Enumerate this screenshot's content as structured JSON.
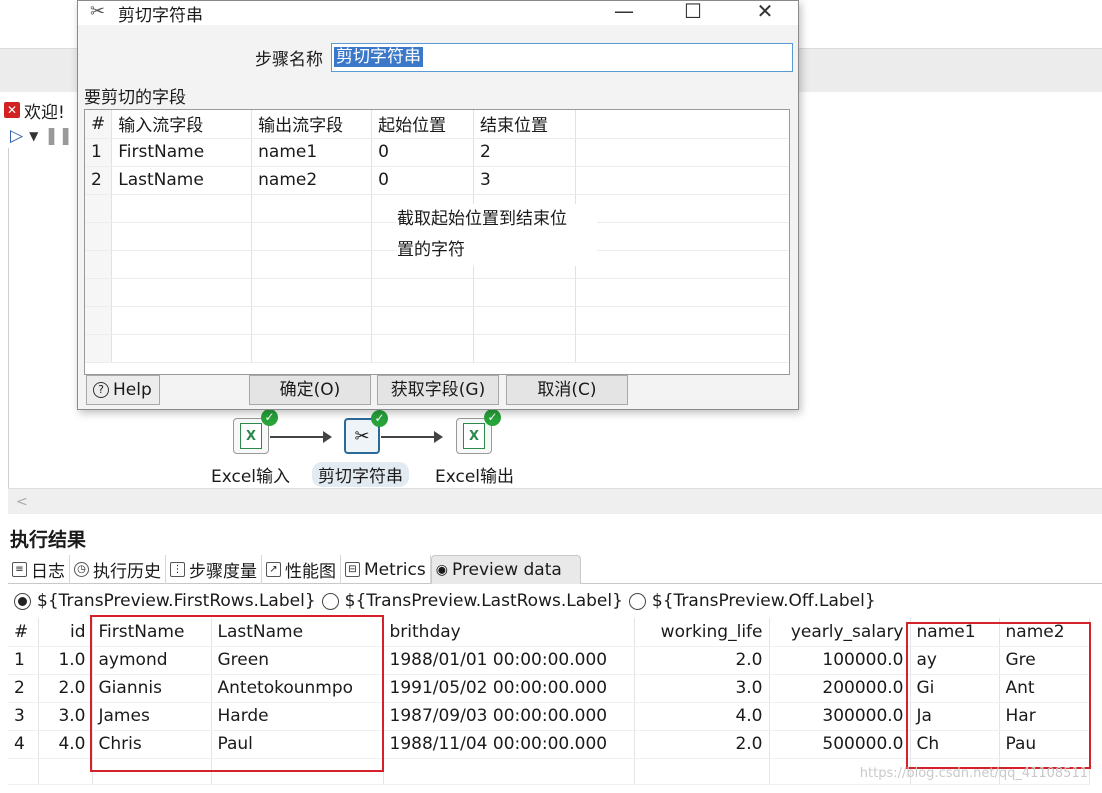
{
  "app": {
    "welcome_tab": "欢迎!",
    "welcome_icon": "close-icon",
    "scroll_left_glyph": "<"
  },
  "flow": {
    "nodes": [
      {
        "label": "Excel输入",
        "icon": "excel-input-icon"
      },
      {
        "label": "剪切字符串",
        "icon": "scissors-icon"
      },
      {
        "label": "Excel输出",
        "icon": "excel-output-icon"
      }
    ]
  },
  "results": {
    "title": "执行结果",
    "tabs": [
      "日志",
      "执行历史",
      "步骤度量",
      "性能图",
      "Metrics",
      "Preview data"
    ],
    "radios": [
      {
        "label": "${TransPreview.FirstRows.Label}",
        "checked": true
      },
      {
        "label": "${TransPreview.LastRows.Label}",
        "checked": false
      },
      {
        "label": "${TransPreview.Off.Label}",
        "checked": false
      }
    ],
    "columns": [
      "#",
      "id",
      "FirstName",
      "LastName",
      "brithday",
      "working_life",
      "yearly_salary",
      "name1",
      "name2"
    ],
    "rows": [
      [
        "1",
        "1.0",
        "aymond",
        "Green",
        "1988/01/01 00:00:00.000",
        "2.0",
        "100000.0",
        "ay",
        "Gre"
      ],
      [
        "2",
        "2.0",
        "Giannis",
        "Antetokounmpo",
        "1991/05/02 00:00:00.000",
        "3.0",
        "200000.0",
        "Gi",
        "Ant"
      ],
      [
        "3",
        "3.0",
        "James",
        "Harde",
        "1987/09/03 00:00:00.000",
        "4.0",
        "300000.0",
        "Ja",
        "Har"
      ],
      [
        "4",
        "4.0",
        "Chris",
        "Paul",
        "1988/11/04 00:00:00.000",
        "2.0",
        "500000.0",
        "Ch",
        "Pau"
      ]
    ],
    "highlight_color": "#d4222a",
    "watermark": "https://blog.csdn.net/qq_41108511"
  },
  "dialog": {
    "title": "剪切字符串",
    "step_name_label": "步骤名称",
    "step_name_value": "剪切字符串",
    "fields_label": "要剪切的字段",
    "columns": [
      "#",
      "输入流字段",
      "输出流字段",
      "起始位置",
      "结束位置"
    ],
    "rows": [
      [
        "1",
        "FirstName",
        "name1",
        "0",
        "2"
      ],
      [
        "2",
        "LastName",
        "name2",
        "0",
        "3"
      ]
    ],
    "annotation_line1": "截取起始位置到结束位",
    "annotation_line2": "置的字符",
    "help_label": "Help",
    "ok_label": "确定(O)",
    "get_fields_label": "获取字段(G)",
    "cancel_label": "取消(C)",
    "minimize_glyph": "—",
    "maximize_glyph": "☐",
    "close_glyph": "✕"
  }
}
